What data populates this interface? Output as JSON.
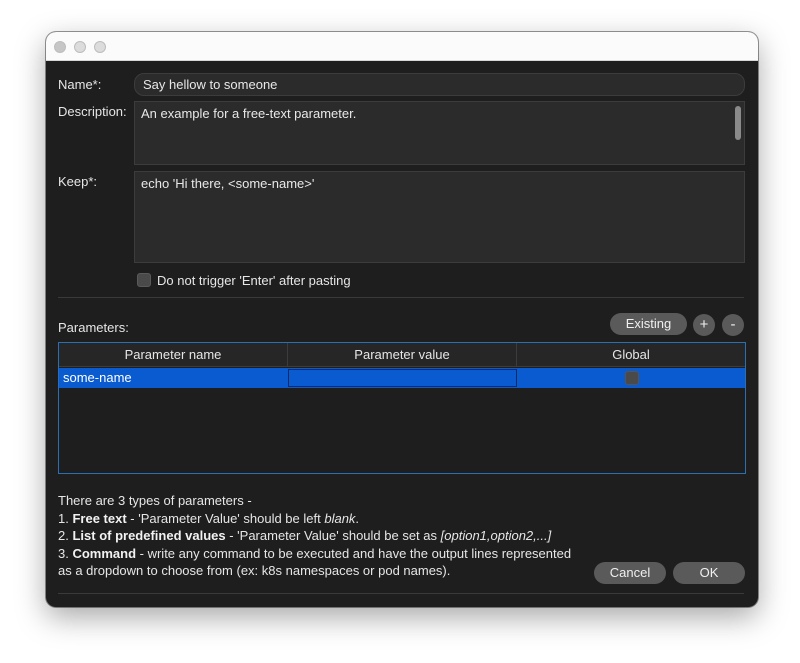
{
  "window": {
    "controls": [
      "close",
      "minimize",
      "zoom"
    ]
  },
  "form": {
    "name_label": "Name*:",
    "name_value": "Say hellow to someone",
    "description_label": "Description:",
    "description_value": "An example for a free-text parameter.",
    "keep_label": "Keep*:",
    "keep_value": "echo 'Hi there, <some-name>'",
    "no_enter_label": "Do not trigger 'Enter' after pasting",
    "no_enter_checked": false
  },
  "parameters": {
    "label": "Parameters:",
    "existing_button": "Existing",
    "add_button": "+",
    "remove_button": "-",
    "columns": [
      "Parameter name",
      "Parameter value",
      "Global"
    ],
    "rows": [
      {
        "name": "some-name",
        "value": "",
        "global": false
      }
    ]
  },
  "help": {
    "intro": "There are 3 types of parameters -",
    "items": [
      {
        "num": "1. ",
        "title": "Free text",
        "text": " - 'Parameter Value' should be left ",
        "em": "blank",
        "tail": "."
      },
      {
        "num": "2. ",
        "title": "List of predefined values",
        "text": " - 'Parameter Value' should be set as ",
        "em": "[option1,option2,...]",
        "tail": ""
      },
      {
        "num": "3. ",
        "title": "Command",
        "text": " - write any command to be executed and have the output lines represented",
        "em": "",
        "tail": ""
      }
    ],
    "continuation": "as a dropdown to choose from (ex: k8s namespaces or pod names)."
  },
  "actions": {
    "cancel": "Cancel",
    "ok": "OK"
  },
  "colors": {
    "window_bg": "#1e1e1e",
    "selection": "#0a5bd0",
    "button": "#5a5a5a",
    "table_border": "#2a6fb3"
  }
}
